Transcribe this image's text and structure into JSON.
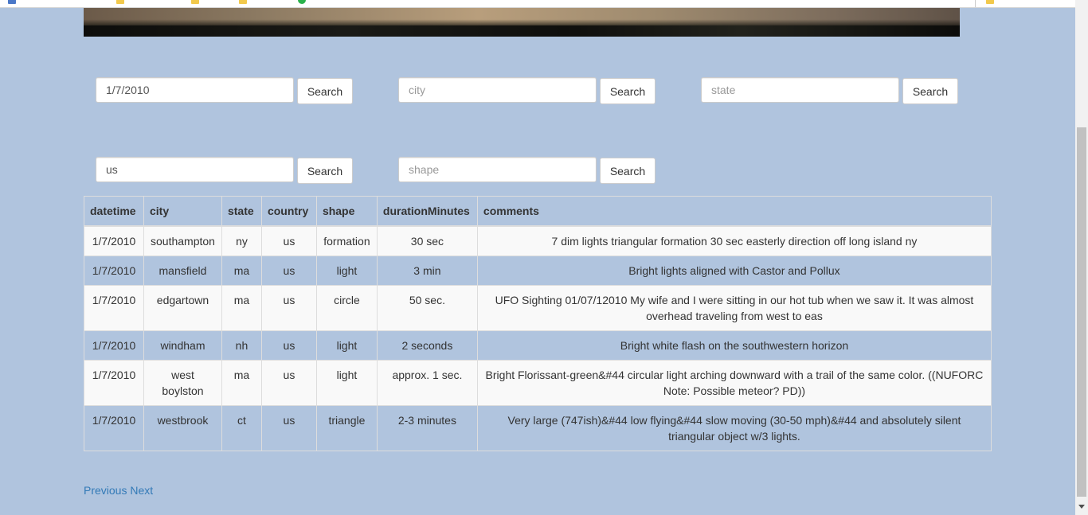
{
  "search": {
    "date": {
      "value": "1/7/2010",
      "placeholder": "",
      "button": "Search"
    },
    "city": {
      "value": "",
      "placeholder": "city",
      "button": "Search"
    },
    "state": {
      "value": "",
      "placeholder": "state",
      "button": "Search"
    },
    "country": {
      "value": "us",
      "placeholder": "",
      "button": "Search"
    },
    "shape": {
      "value": "",
      "placeholder": "shape",
      "button": "Search"
    }
  },
  "table": {
    "headers": [
      "datetime",
      "city",
      "state",
      "country",
      "shape",
      "durationMinutes",
      "comments"
    ],
    "rows": [
      [
        "1/7/2010",
        "southampton",
        "ny",
        "us",
        "formation",
        "30 sec",
        "7 dim lights triangular formation 30 sec easterly direction off long island ny"
      ],
      [
        "1/7/2010",
        "mansfield",
        "ma",
        "us",
        "light",
        "3 min",
        "Bright lights aligned with Castor and Pollux"
      ],
      [
        "1/7/2010",
        "edgartown",
        "ma",
        "us",
        "circle",
        "50 sec.",
        "UFO Sighting 01/07/12010 My wife and I were sitting in our hot tub when we saw it. It was almost overhead traveling from west to eas"
      ],
      [
        "1/7/2010",
        "windham",
        "nh",
        "us",
        "light",
        "2 seconds",
        "Bright white flash on the southwestern horizon"
      ],
      [
        "1/7/2010",
        "west boylston",
        "ma",
        "us",
        "light",
        "approx. 1 sec.",
        "Bright Florissant-green&#44 circular light arching downward with a trail of the same color. ((NUFORC Note: Possible meteor? PD))"
      ],
      [
        "1/7/2010",
        "westbrook",
        "ct",
        "us",
        "triangle",
        "2-3 minutes",
        "Very large (747ish)&#44 low flying&#44 slow moving (30-50 mph)&#44 and absolutely silent triangular object w/3 lights."
      ]
    ]
  },
  "pagination": {
    "previous": "Previous",
    "next": "Next"
  },
  "colors": {
    "page_background": "#b0c4de",
    "link": "#337ab7",
    "odd_row": "#f9f9f9"
  }
}
